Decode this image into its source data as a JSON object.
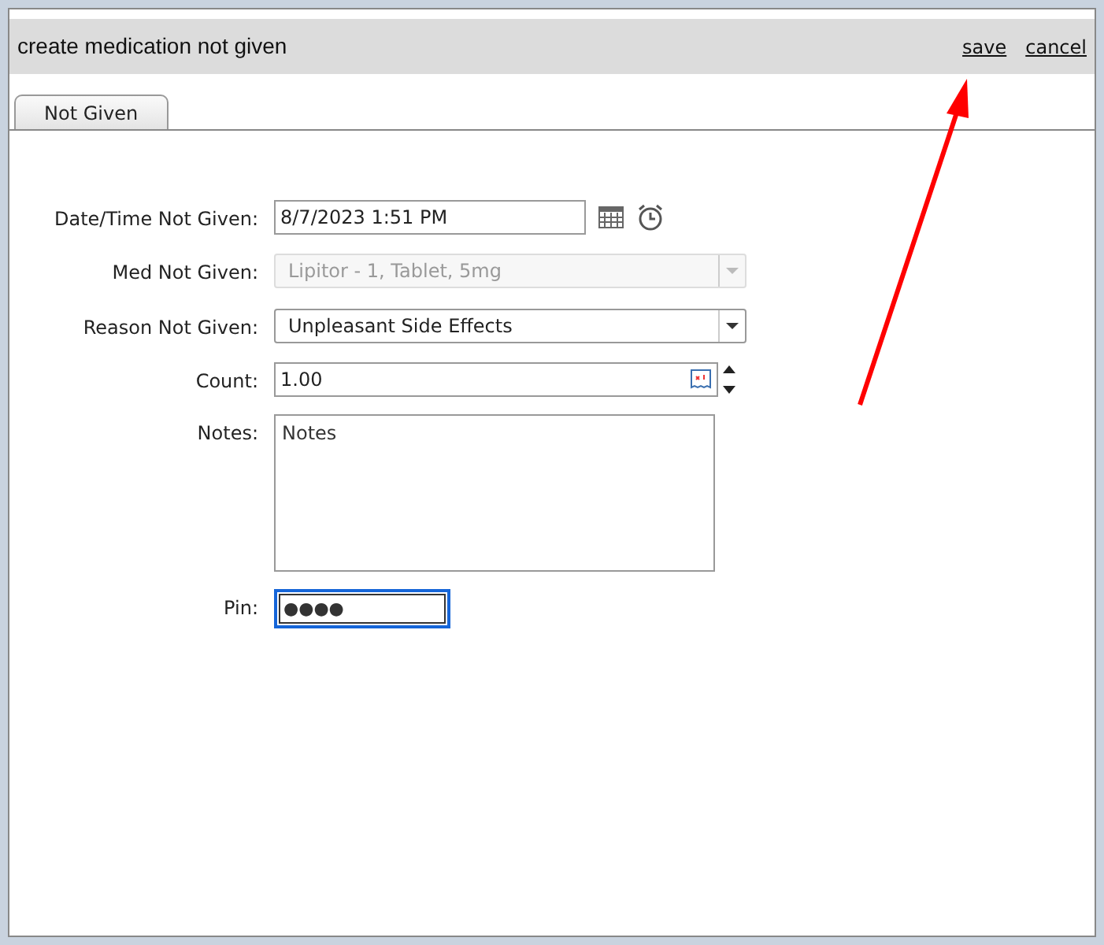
{
  "dialog": {
    "title": "create medication not given",
    "actions": [
      {
        "label": "save"
      },
      {
        "label": "cancel"
      }
    ]
  },
  "tabs": [
    {
      "label": "Not Given",
      "selected": true
    }
  ],
  "fields": [
    {
      "kind": "datetime",
      "label": "Date/Time Not Given:",
      "value": "8/7/2023 1:51 PM"
    },
    {
      "kind": "select",
      "label": "Med Not Given:",
      "value": "Lipitor - 1, Tablet, 5mg",
      "disabled": true
    },
    {
      "kind": "select",
      "label": "Reason Not Given:",
      "value": "Unpleasant Side Effects",
      "disabled": false
    },
    {
      "kind": "number",
      "label": "Count:",
      "value": "1.00"
    },
    {
      "kind": "textarea",
      "label": "Notes:",
      "value": "Notes"
    },
    {
      "kind": "password",
      "label": "Pin:",
      "value": "●●●●",
      "focused": true
    }
  ],
  "annotation": {
    "kind": "arrow"
  }
}
